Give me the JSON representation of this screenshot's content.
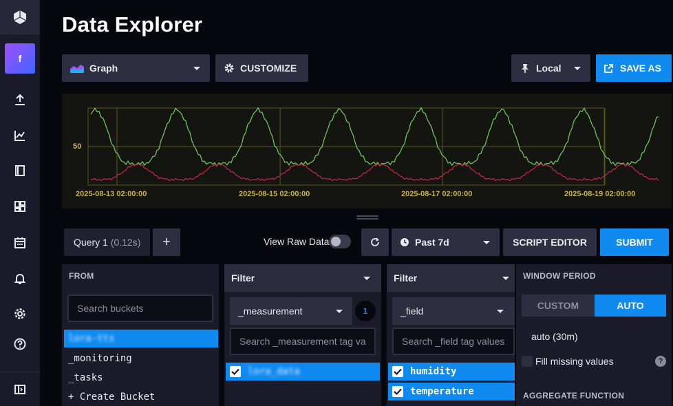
{
  "header": {
    "title": "Data Explorer"
  },
  "sidebar": {
    "org_initial": "f"
  },
  "toolbar": {
    "viz_type": "Graph",
    "customize_label": "CUSTOMIZE",
    "timezone": "Local",
    "save_as_label": "SAVE AS"
  },
  "graph": {
    "y_tick": "50",
    "x_ticks": [
      "2025-08-13 02:00:00",
      "2025-08-15 02:00:00",
      "2025-08-17 02:00:00",
      "2025-08-19 02:00:00"
    ]
  },
  "query": {
    "tab_label": "Query 1",
    "tab_time": "(0.12s)",
    "add_label": "+",
    "view_raw_label": "View Raw Data",
    "time_range": "Past 7d",
    "script_editor_label": "SCRIPT EDITOR",
    "submit_label": "SUBMIT"
  },
  "from_panel": {
    "title": "FROM",
    "search_placeholder": "Search buckets",
    "buckets": [
      "lora-tts",
      "_monitoring",
      "_tasks",
      "+ Create Bucket"
    ]
  },
  "filter1": {
    "title": "Filter",
    "key": "_measurement",
    "count": "1",
    "search_placeholder": "Search _measurement tag va",
    "values": [
      "lora_data"
    ]
  },
  "filter2": {
    "title": "Filter",
    "key": "_field",
    "search_placeholder": "Search _field tag values",
    "values": [
      "humidity",
      "temperature"
    ]
  },
  "window": {
    "title": "WINDOW PERIOD",
    "custom_label": "CUSTOM",
    "auto_label": "AUTO",
    "auto_value": "auto (30m)",
    "fill_missing_label": "Fill missing values",
    "help": "?",
    "aggregate_title": "AGGREGATE FUNCTION"
  },
  "colors": {
    "accent_blue": "#0f8af0",
    "humidity_line": "#6cc55a",
    "temperature_line": "#c0244a",
    "graph_grid": "#6e6a1f",
    "tick_text": "#c8b44a"
  }
}
